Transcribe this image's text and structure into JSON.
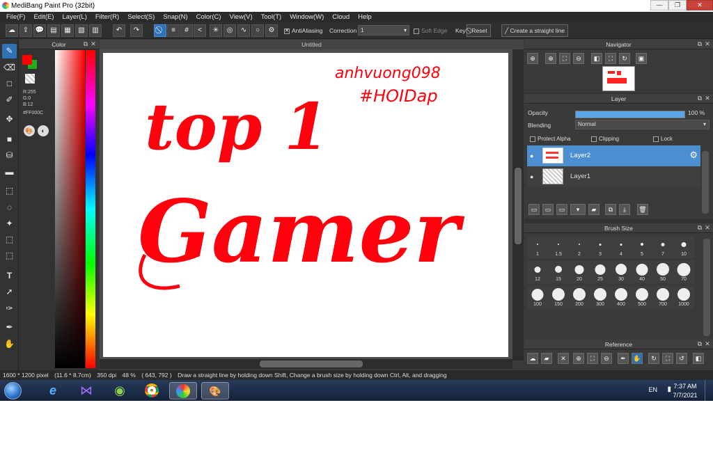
{
  "window": {
    "title": "MediBang Paint Pro (32bit)",
    "minimize": "—",
    "restore": "❐",
    "close": "✕"
  },
  "menu": [
    "File(F)",
    "Edit(E)",
    "Layer(L)",
    "Filter(R)",
    "Select(S)",
    "Snap(N)",
    "Color(C)",
    "View(V)",
    "Tool(T)",
    "Window(W)",
    "Cloud",
    "Help"
  ],
  "toolbar": {
    "antialiasing_label": "AntiAliasing",
    "antialiasing_checked": true,
    "correction_label": "Correction",
    "correction_value": "1",
    "soft_edge_label": "Soft Edge",
    "key_label": "Key",
    "reset_label": "Reset",
    "straight_line_label": "Create a straight line"
  },
  "color_panel": {
    "title": "Color",
    "r": "R:255",
    "g": "G:0",
    "b": "B:12",
    "hex": "#FF000C",
    "fg_color": "#FF000C",
    "bg_color": "#1DB01D"
  },
  "document": {
    "tab_title": "Untitled",
    "canvas_text_1": "top 1",
    "canvas_text_2": "Gamer",
    "signature_1": "anhvuong098",
    "signature_2": "#HOIDap"
  },
  "navigator": {
    "title": "Navigator"
  },
  "layer_panel": {
    "title": "Layer",
    "opacity_label": "Opacity",
    "opacity_value": "100 %",
    "opacity_fraction": 1.0,
    "blending_label": "Blending",
    "blending_value": "Normal",
    "protect_alpha_label": "Protect Alpha",
    "clipping_label": "Clipping",
    "lock_label": "Lock",
    "layers": [
      {
        "name": "Layer2",
        "selected": true
      },
      {
        "name": "Layer1",
        "selected": false
      }
    ]
  },
  "brush_size": {
    "title": "Brush Size",
    "sizes": [
      "1",
      "1.5",
      "2",
      "3",
      "4",
      "5",
      "7",
      "10",
      "12",
      "15",
      "20",
      "25",
      "30",
      "40",
      "50",
      "70",
      "100",
      "150",
      "200",
      "300",
      "400",
      "500",
      "700",
      "1000"
    ]
  },
  "reference": {
    "title": "Reference"
  },
  "status": {
    "canvas_size": "1600 * 1200 pixel",
    "physical_size": "(11.6 * 8.7cm)",
    "dpi": "350 dpi",
    "zoom": "48 %",
    "cursor": "( 643, 792 )",
    "hint": "Draw a straight line by holding down Shift, Change a brush size by holding down Ctrl, Alt, and dragging"
  },
  "taskbar": {
    "language": "EN",
    "time": "7:37 AM",
    "date": "7/7/2021"
  },
  "colors": {
    "accent": "#2F72B6",
    "paint": "#FF000C"
  }
}
